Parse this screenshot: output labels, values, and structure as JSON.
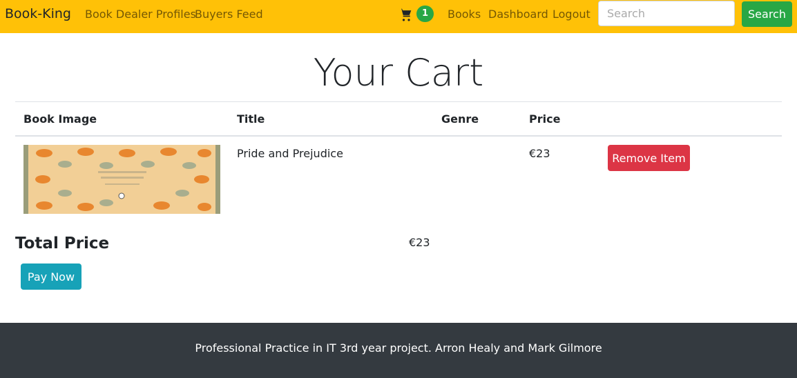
{
  "navbar": {
    "brand": "Book-King",
    "left_links": [
      "Book Dealer Profiles",
      "Buyers Feed"
    ],
    "cart_count": "1",
    "right_links": [
      "Books",
      "Dashboard",
      "Logout"
    ],
    "search_placeholder": "Search",
    "search_button": "Search"
  },
  "page": {
    "title": "Your Cart"
  },
  "table": {
    "headers": [
      "Book Image",
      "Title",
      "Genre",
      "Price"
    ],
    "rows": [
      {
        "title": "Pride and Prejudice",
        "genre": "",
        "price": "€23",
        "remove_label": "Remove Item"
      }
    ]
  },
  "totals": {
    "label": "Total Price",
    "value": "€23",
    "pay_label": "Pay Now"
  },
  "footer": {
    "text": "Professional Practice in IT 3rd year project. Arron Healy and Mark Gilmore"
  },
  "colors": {
    "navbar": "#ffc107",
    "cart_badge": "#28a745",
    "search_button": "#28a745",
    "remove_button": "#dc3545",
    "pay_button": "#17a2b8",
    "footer": "#343a40"
  },
  "icons": {
    "cart": "shopping-cart-icon"
  }
}
